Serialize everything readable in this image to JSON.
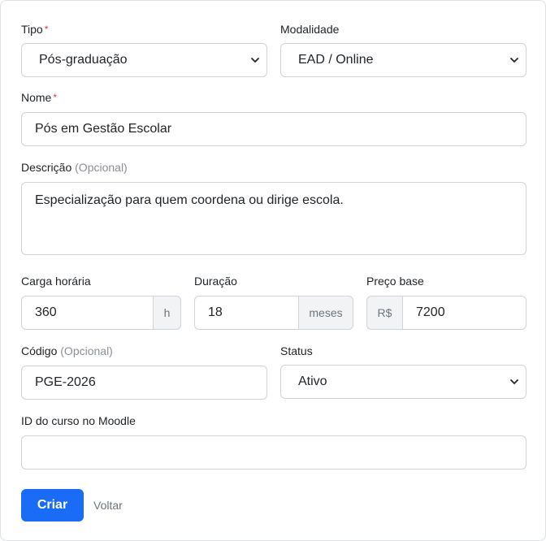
{
  "tipo": {
    "label": "Tipo",
    "required_mark": "*",
    "value": "Pós-graduação"
  },
  "modalidade": {
    "label": "Modalidade",
    "value": "EAD / Online"
  },
  "nome": {
    "label": "Nome",
    "required_mark": "*",
    "value": "Pós em Gestão Escolar"
  },
  "descricao": {
    "label": "Descrição",
    "optional": "(Opcional)",
    "value": "Especialização para quem coordena ou dirige escola."
  },
  "carga_horaria": {
    "label": "Carga horária",
    "value": "360",
    "unit": "h"
  },
  "duracao": {
    "label": "Duração",
    "value": "18",
    "unit": "meses"
  },
  "preco_base": {
    "label": "Preço base",
    "prefix": "R$",
    "value": "7200"
  },
  "codigo": {
    "label": "Código",
    "optional": "(Opcional)",
    "value": "PGE-2026"
  },
  "status": {
    "label": "Status",
    "value": "Ativo"
  },
  "moodle_id": {
    "label": "ID do curso no Moodle",
    "value": ""
  },
  "actions": {
    "submit_label": "Criar",
    "back_label": "Voltar"
  },
  "colors": {
    "primary": "#1a6cf6",
    "required": "#dc3545",
    "border": "#ced4da",
    "addon_bg": "#f1f3f5"
  }
}
